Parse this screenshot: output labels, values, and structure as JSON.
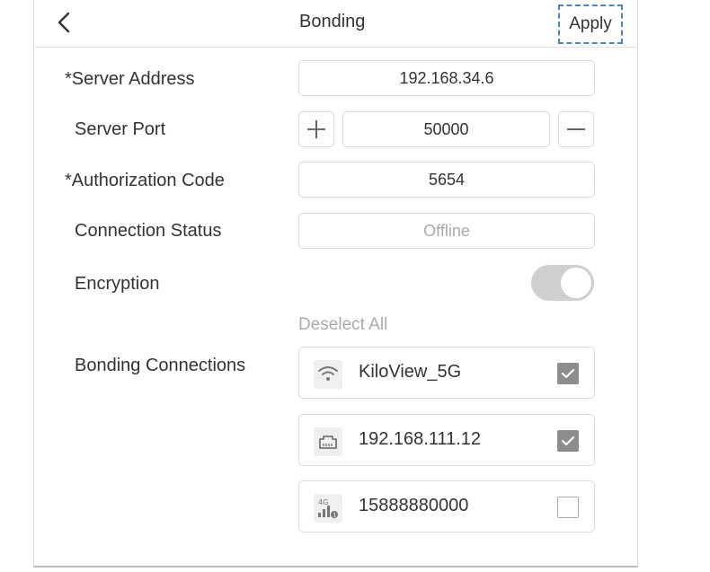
{
  "header": {
    "title": "Bonding",
    "apply_label": "Apply"
  },
  "form": {
    "server_address": {
      "label": "*Server Address",
      "value": "192.168.34.6"
    },
    "server_port": {
      "label": "Server Port",
      "value": "50000"
    },
    "authorization_code": {
      "label": "*Authorization Code",
      "value": "5654"
    },
    "connection_status": {
      "label": "Connection Status",
      "value": "Offline"
    },
    "encryption": {
      "label": "Encryption",
      "enabled": true
    },
    "bonding": {
      "label": "Bonding Connections",
      "deselect_all": "Deselect All",
      "items": [
        {
          "name": "KiloView_5G",
          "icon": "wifi-icon",
          "checked": true
        },
        {
          "name": "192.168.111.12",
          "icon": "ethernet-icon",
          "checked": true
        },
        {
          "name": "15888880000",
          "icon": "cellular-4g-icon",
          "icon_text": "4G",
          "checked": false
        }
      ]
    }
  },
  "colors": {
    "apply_border": "#4a84c4",
    "checkbox_checked": "#8c8c8c",
    "toggle_track": "#cfcfcf"
  }
}
